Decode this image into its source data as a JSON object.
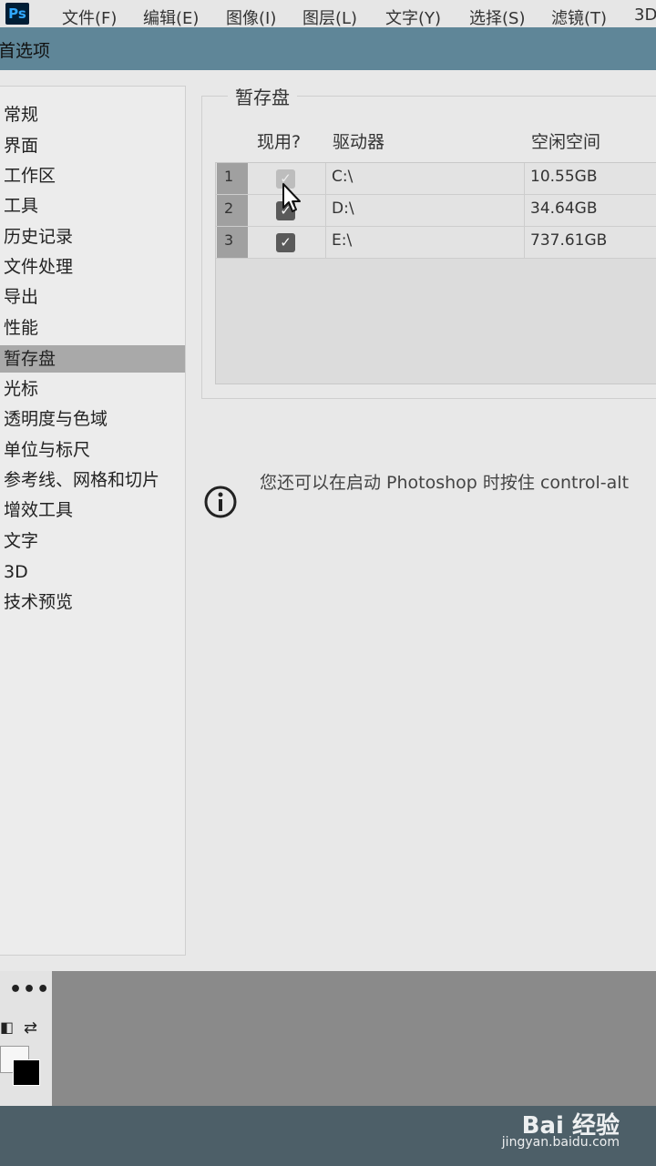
{
  "app": {
    "logo": "Ps",
    "menu": [
      "文件(F)",
      "编辑(E)",
      "图像(I)",
      "图层(L)",
      "文字(Y)",
      "选择(S)",
      "滤镜(T)",
      "3D"
    ]
  },
  "dialog": {
    "title": "首选项",
    "sidebar": [
      {
        "label": "常规"
      },
      {
        "label": "界面"
      },
      {
        "label": "工作区"
      },
      {
        "label": "工具"
      },
      {
        "label": "历史记录"
      },
      {
        "label": "文件处理"
      },
      {
        "label": "导出"
      },
      {
        "label": "性能"
      },
      {
        "label": "暂存盘",
        "active": true
      },
      {
        "label": "光标"
      },
      {
        "label": "透明度与色域"
      },
      {
        "label": "单位与标尺"
      },
      {
        "label": "参考线、网格和切片"
      },
      {
        "label": "增效工具"
      },
      {
        "label": "文字"
      },
      {
        "label": "3D"
      },
      {
        "label": "技术预览"
      }
    ],
    "scratch": {
      "group_title": "暂存盘",
      "columns": {
        "active": "现用?",
        "drive": "驱动器",
        "free": "空闲空间"
      },
      "rows": [
        {
          "num": "1",
          "checked": true,
          "dimmed": true,
          "drive": "C:\\",
          "free": "10.55GB"
        },
        {
          "num": "2",
          "checked": true,
          "dimmed": false,
          "drive": "D:\\",
          "free": "34.64GB"
        },
        {
          "num": "3",
          "checked": true,
          "dimmed": false,
          "drive": "E:\\",
          "free": "737.61GB"
        }
      ],
      "info_text": "您还可以在启动 Photoshop 时按住 control-alt"
    }
  },
  "toolbar": {
    "more": "•••"
  },
  "watermark": {
    "brand": "Bai 经验",
    "url": "jingyan.baidu.com"
  }
}
